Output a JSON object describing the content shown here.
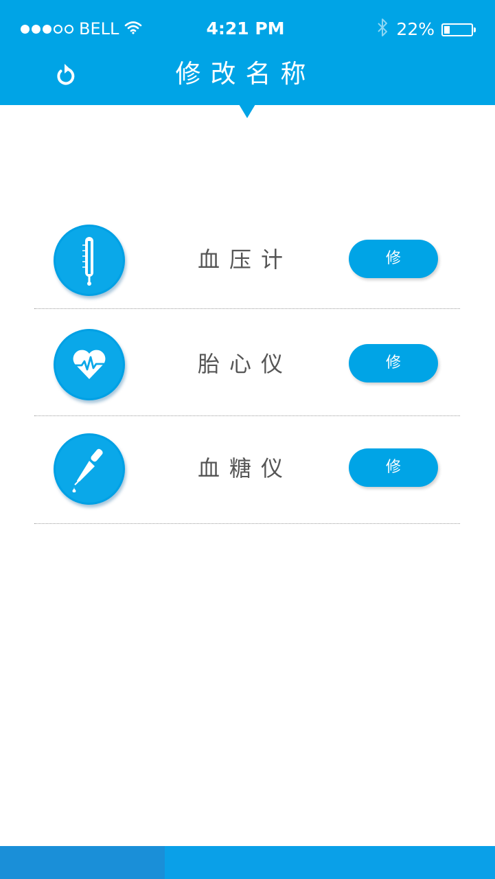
{
  "status_bar": {
    "carrier": "BELL",
    "signal_strength": 3,
    "signal_max": 5,
    "time": "4:21 PM",
    "battery_percent_label": "22%",
    "battery_level": 0.22,
    "icons": [
      "wifi-icon",
      "bluetooth-icon",
      "battery-icon"
    ]
  },
  "header": {
    "title": "修改名称",
    "back_icon": "refresh-back-icon",
    "background_color": "#00a4e6"
  },
  "devices": [
    {
      "name": "血压计",
      "icon": "thermometer-icon",
      "button_label": "修改"
    },
    {
      "name": "胎心仪",
      "icon": "heartbeat-icon",
      "button_label": "修改"
    },
    {
      "name": "血糖仪",
      "icon": "dropper-icon",
      "button_label": "修改"
    }
  ],
  "bottom_tabs": {
    "colors": [
      "#1a8fd8",
      "#0aa0e8",
      "#0aa0e8"
    ]
  },
  "colors": {
    "accent": "#00a4e6",
    "text": "#555555",
    "divider": "#9a9a9a"
  }
}
